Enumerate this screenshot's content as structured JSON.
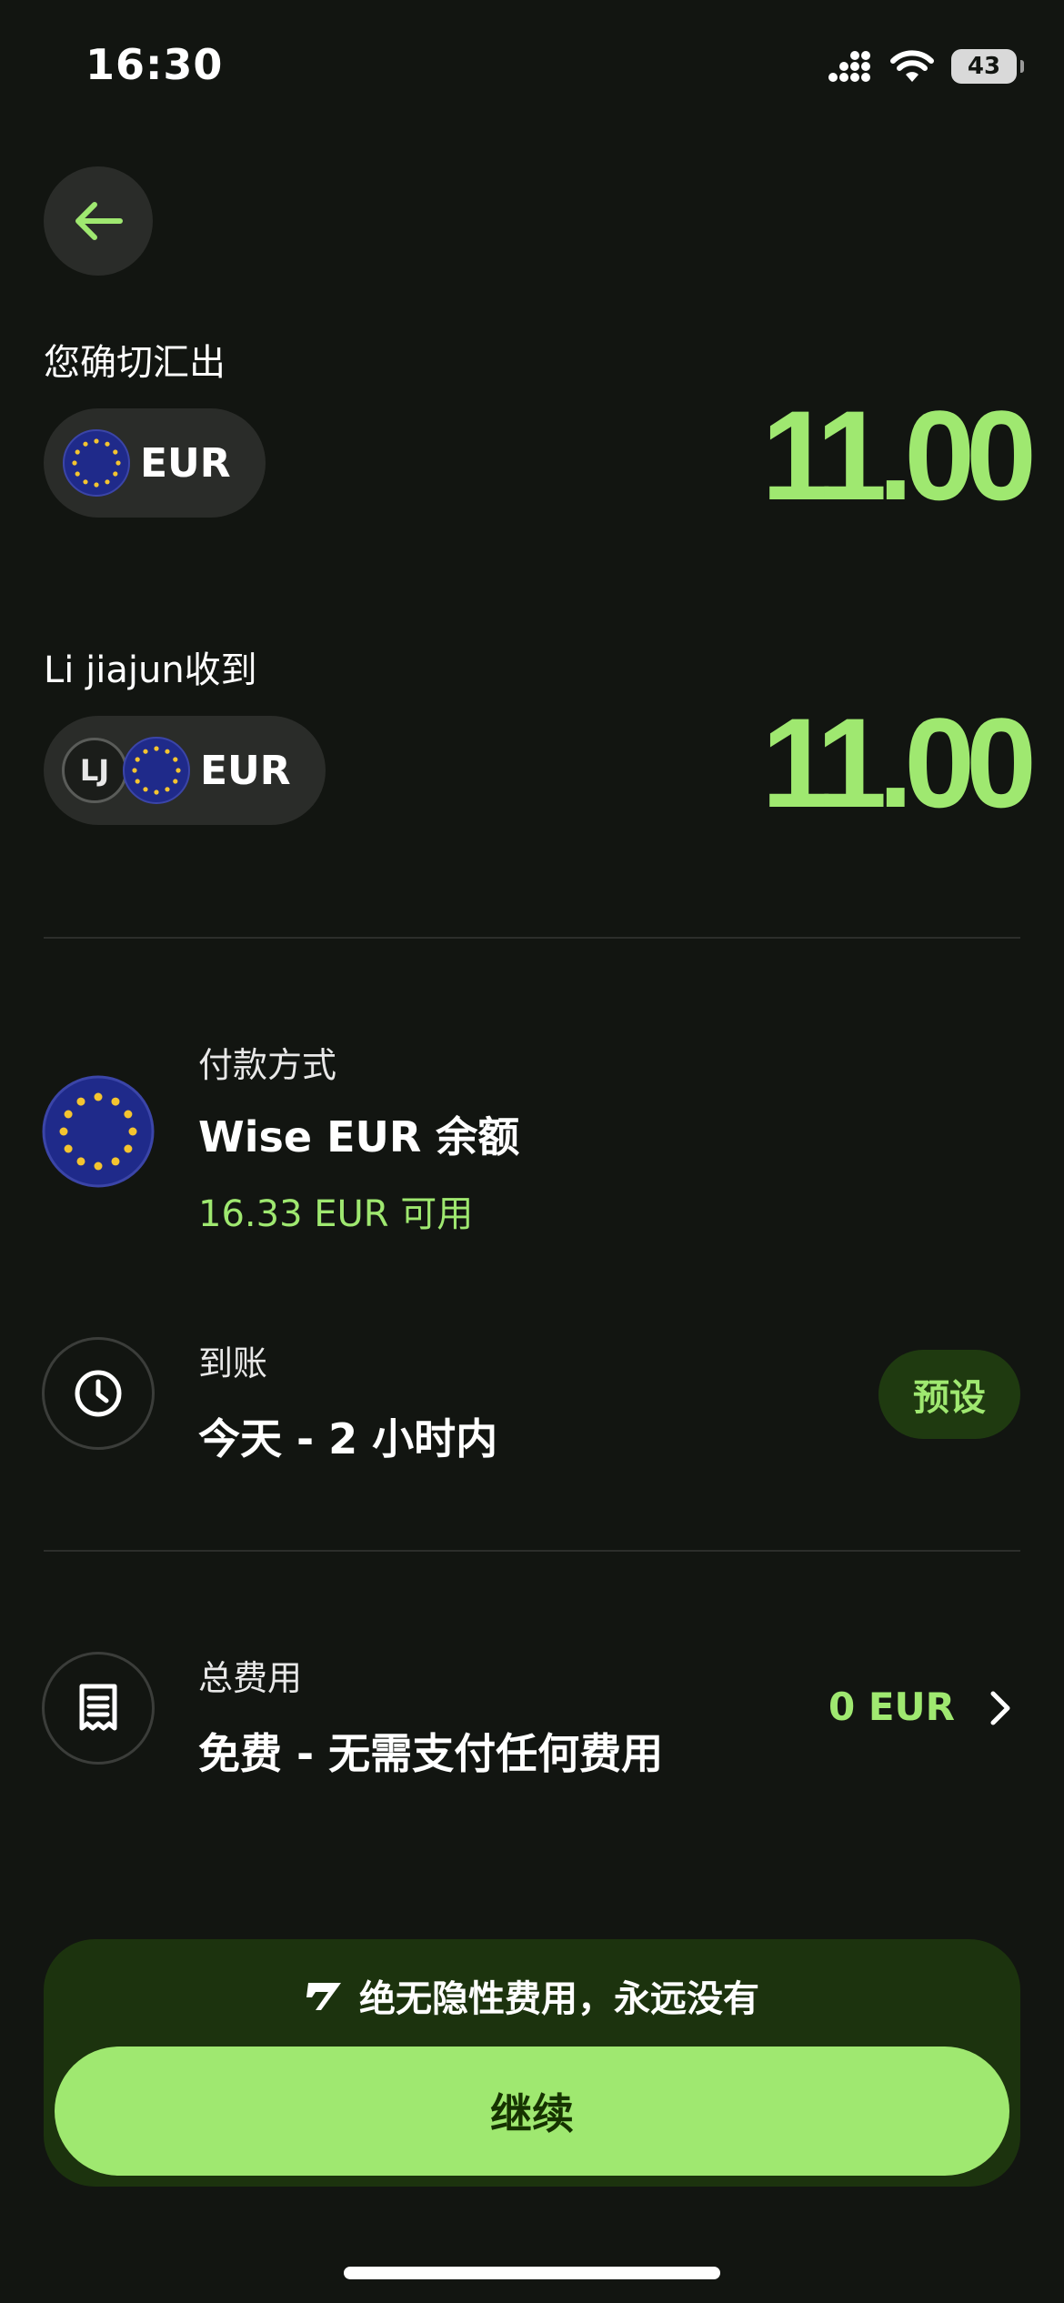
{
  "status_bar": {
    "time": "16:30",
    "battery": "43"
  },
  "send": {
    "label": "您确切汇出",
    "currency": "EUR",
    "amount": "11.00"
  },
  "receive": {
    "label": "Li jiajun收到",
    "initials": "LJ",
    "currency": "EUR",
    "amount": "11.00"
  },
  "payment": {
    "title": "付款方式",
    "method": "Wise EUR 余额",
    "available": "16.33 EUR 可用"
  },
  "arrival": {
    "title": "到账",
    "value": "今天 - 2 小时内",
    "tag": "预设"
  },
  "fees": {
    "title": "总费用",
    "value": "免费 - 无需支付任何费用",
    "amount": "0 EUR"
  },
  "footer": {
    "note": "绝无隐性费用，永远没有",
    "continue_label": "继续"
  },
  "colors": {
    "accent": "#9fe870",
    "background": "#121511",
    "panel": "#1c330e",
    "eu_blue": "#1f2a8a",
    "eu_star": "#f4c430"
  },
  "icons": [
    "back-arrow-icon",
    "signal-icon",
    "wifi-icon",
    "battery-icon",
    "eu-flag-icon",
    "clock-icon",
    "receipt-icon",
    "chevron-right-icon",
    "wise-logo-icon"
  ]
}
